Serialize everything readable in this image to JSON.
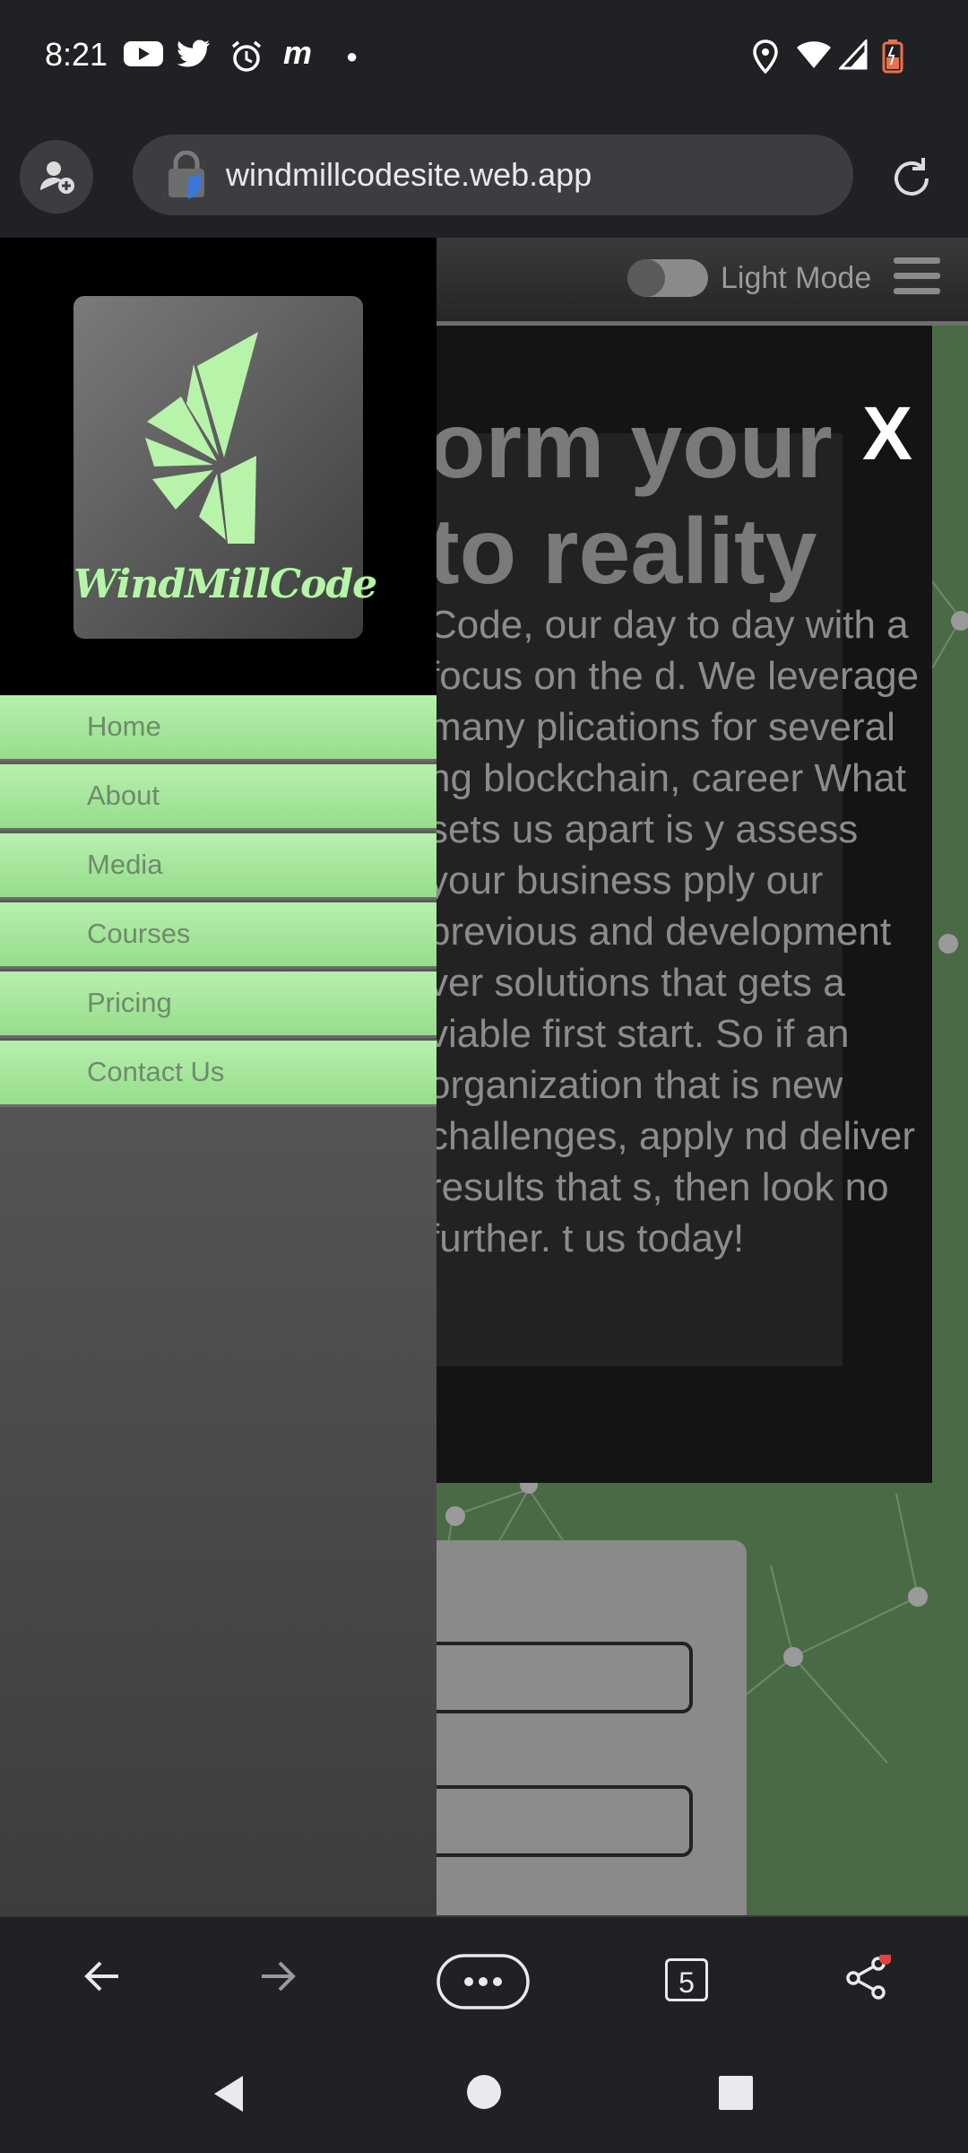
{
  "status_bar": {
    "time": "8:21"
  },
  "browser": {
    "url": "windmillcodesite.web.app",
    "open_tabs": "5"
  },
  "site": {
    "theme_toggle_label": "Light Mode",
    "close_label": "X",
    "hero_title_line1": "orm your",
    "hero_title_line2": "to reality",
    "hero_text": "Code, our day to day with a focus on the d. We leverage many plications for several ng blockchain, career What sets us apart is y assess your business pply our previous and development ver solutions that gets a viable first start. So if an organization that is new challenges, apply nd deliver results that s, then look no further. t us today!"
  },
  "drawer": {
    "logo_text": "WindMillCode",
    "menu": [
      {
        "label": "Home"
      },
      {
        "label": "About"
      },
      {
        "label": "Media"
      },
      {
        "label": "Courses"
      },
      {
        "label": "Pricing"
      },
      {
        "label": "Contact Us"
      }
    ]
  },
  "colors": {
    "accent_green": "#a6e59c",
    "drawer_black": "#000000",
    "page_green": "#4a6a46"
  }
}
